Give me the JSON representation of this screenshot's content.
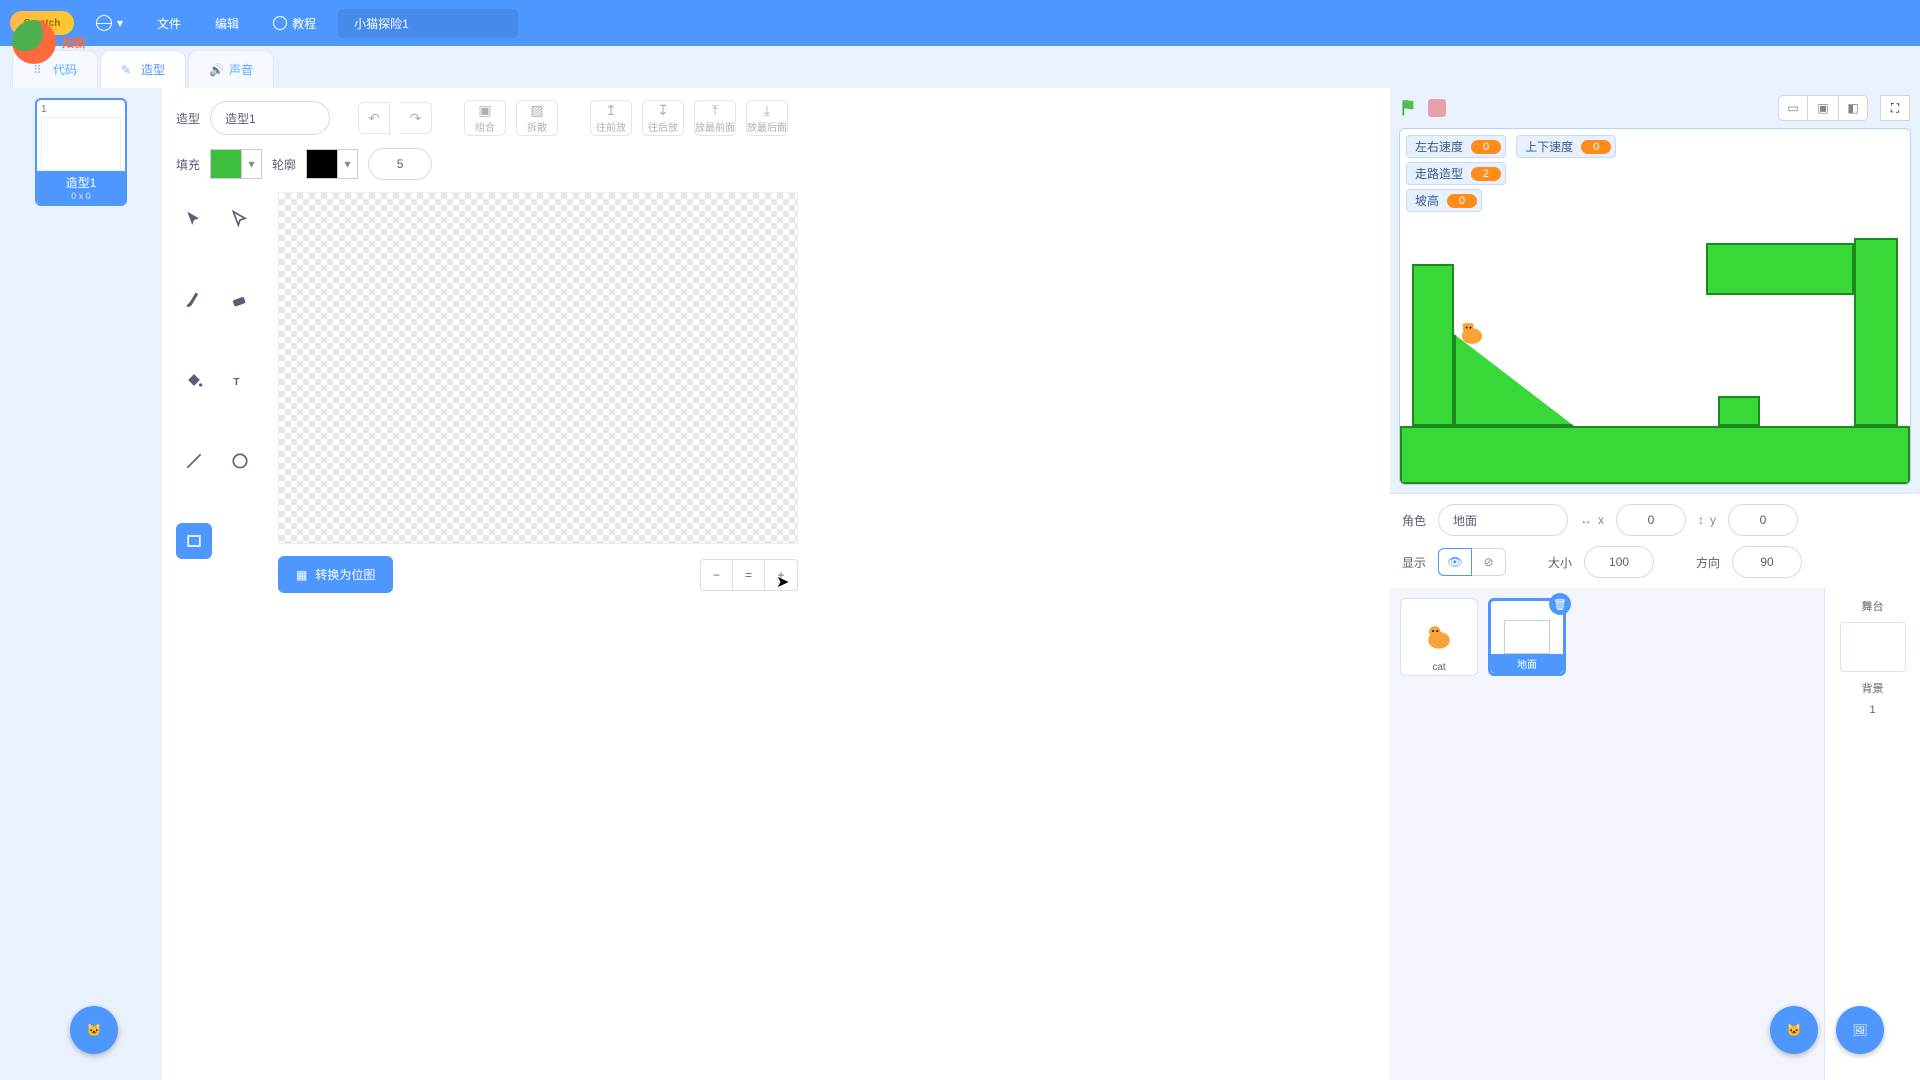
{
  "menubar": {
    "logo": "Scratch",
    "file": "文件",
    "edit": "编辑",
    "tutorials": "教程",
    "project_title": "小猫探险1"
  },
  "watermark": "知新",
  "tabs": {
    "code": "代码",
    "costumes": "造型",
    "sounds": "声音"
  },
  "costume_list": {
    "num": "1",
    "name": "造型1",
    "dims": "0 x 0"
  },
  "editor": {
    "costume_label": "造型",
    "costume_name": "造型1",
    "group": "组合",
    "ungroup": "拆散",
    "forward": "往前放",
    "backward": "往后放",
    "front": "放最前面",
    "back": "放最后面",
    "fill": "填充",
    "outline": "轮廓",
    "outline_width": "5",
    "convert": "转换为位图"
  },
  "monitors": {
    "hspeed_label": "左右速度",
    "hspeed_val": "0",
    "vspeed_label": "上下速度",
    "vspeed_val": "0",
    "walk_label": "走路造型",
    "walk_val": "2",
    "slope_label": "坡高",
    "slope_val": "0"
  },
  "sprite_info": {
    "sprite_label": "角色",
    "sprite_name": "地面",
    "x_label": "x",
    "x_val": "0",
    "y_label": "y",
    "y_val": "0",
    "show_label": "显示",
    "size_label": "大小",
    "size_val": "100",
    "dir_label": "方向",
    "dir_val": "90"
  },
  "sprites": {
    "cat": "cat",
    "ground": "地面"
  },
  "stage_panel": {
    "title": "舞台",
    "backdrops": "背景",
    "count": "1"
  }
}
